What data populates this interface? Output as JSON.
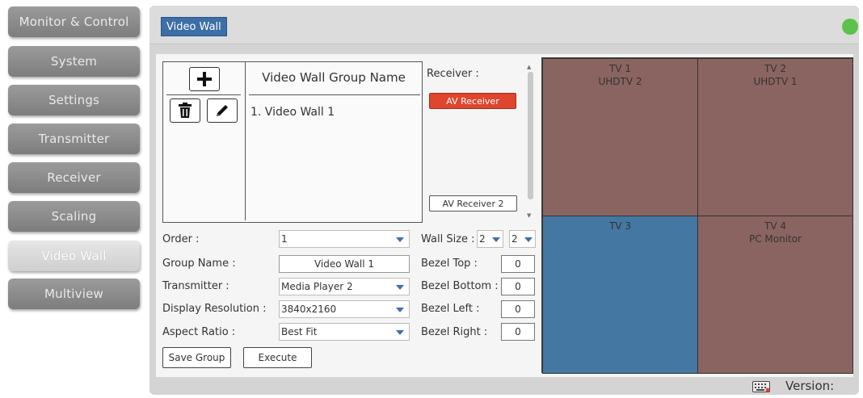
{
  "nav": {
    "items": [
      {
        "label": "Monitor & Control",
        "active": false
      },
      {
        "label": "System",
        "active": false
      },
      {
        "label": "Settings",
        "active": false
      },
      {
        "label": "Transmitter",
        "active": false
      },
      {
        "label": "Receiver",
        "active": false
      },
      {
        "label": "Scaling",
        "active": false
      },
      {
        "label": "Video Wall",
        "active": true
      },
      {
        "label": "Multiview",
        "active": false
      }
    ]
  },
  "header": {
    "title": "Video Wall",
    "status_color": "#5cc24a"
  },
  "group_list": {
    "header": "Video Wall Group Name",
    "add_icon": "plus-icon",
    "delete_icon": "trash-icon",
    "edit_icon": "pencil-icon",
    "items": [
      "1. Video Wall 1"
    ]
  },
  "receivers": {
    "label": "Receiver :",
    "items": [
      {
        "label": "AV Receiver",
        "selected": true,
        "color": "#e0452e"
      },
      {
        "label": "AV Receiver 2",
        "selected": false
      }
    ]
  },
  "form": {
    "order_label": "Order :",
    "order_value": "1",
    "group_name_label": "Group Name :",
    "group_name_value": "Video Wall 1",
    "transmitter_label": "Transmitter :",
    "transmitter_value": "Media Player 2",
    "resolution_label": "Display Resolution :",
    "resolution_value": "3840x2160",
    "aspect_label": "Aspect Ratio :",
    "aspect_value": "Best Fit",
    "wall_size_label": "Wall Size :",
    "wall_cols": "2",
    "wall_rows": "2",
    "bezel_top_label": "Bezel Top :",
    "bezel_top_value": "0",
    "bezel_bottom_label": "Bezel Bottom :",
    "bezel_bottom_value": "0",
    "bezel_left_label": "Bezel Left :",
    "bezel_left_value": "0",
    "bezel_right_label": "Bezel Right :",
    "bezel_right_value": "0",
    "save_label": "Save Group",
    "execute_label": "Execute"
  },
  "wall": {
    "cells": [
      {
        "name": "TV 1",
        "source": "UHDTV 2",
        "color": "#8a6460"
      },
      {
        "name": "TV 2",
        "source": "UHDTV 1",
        "color": "#8a6460"
      },
      {
        "name": "TV 3",
        "source": "",
        "color": "#4477a1"
      },
      {
        "name": "TV 4",
        "source": "PC Monitor",
        "color": "#8a6460"
      }
    ]
  },
  "footer": {
    "keyboard_icon": "keyboard-icon",
    "version_label": "Version:"
  }
}
